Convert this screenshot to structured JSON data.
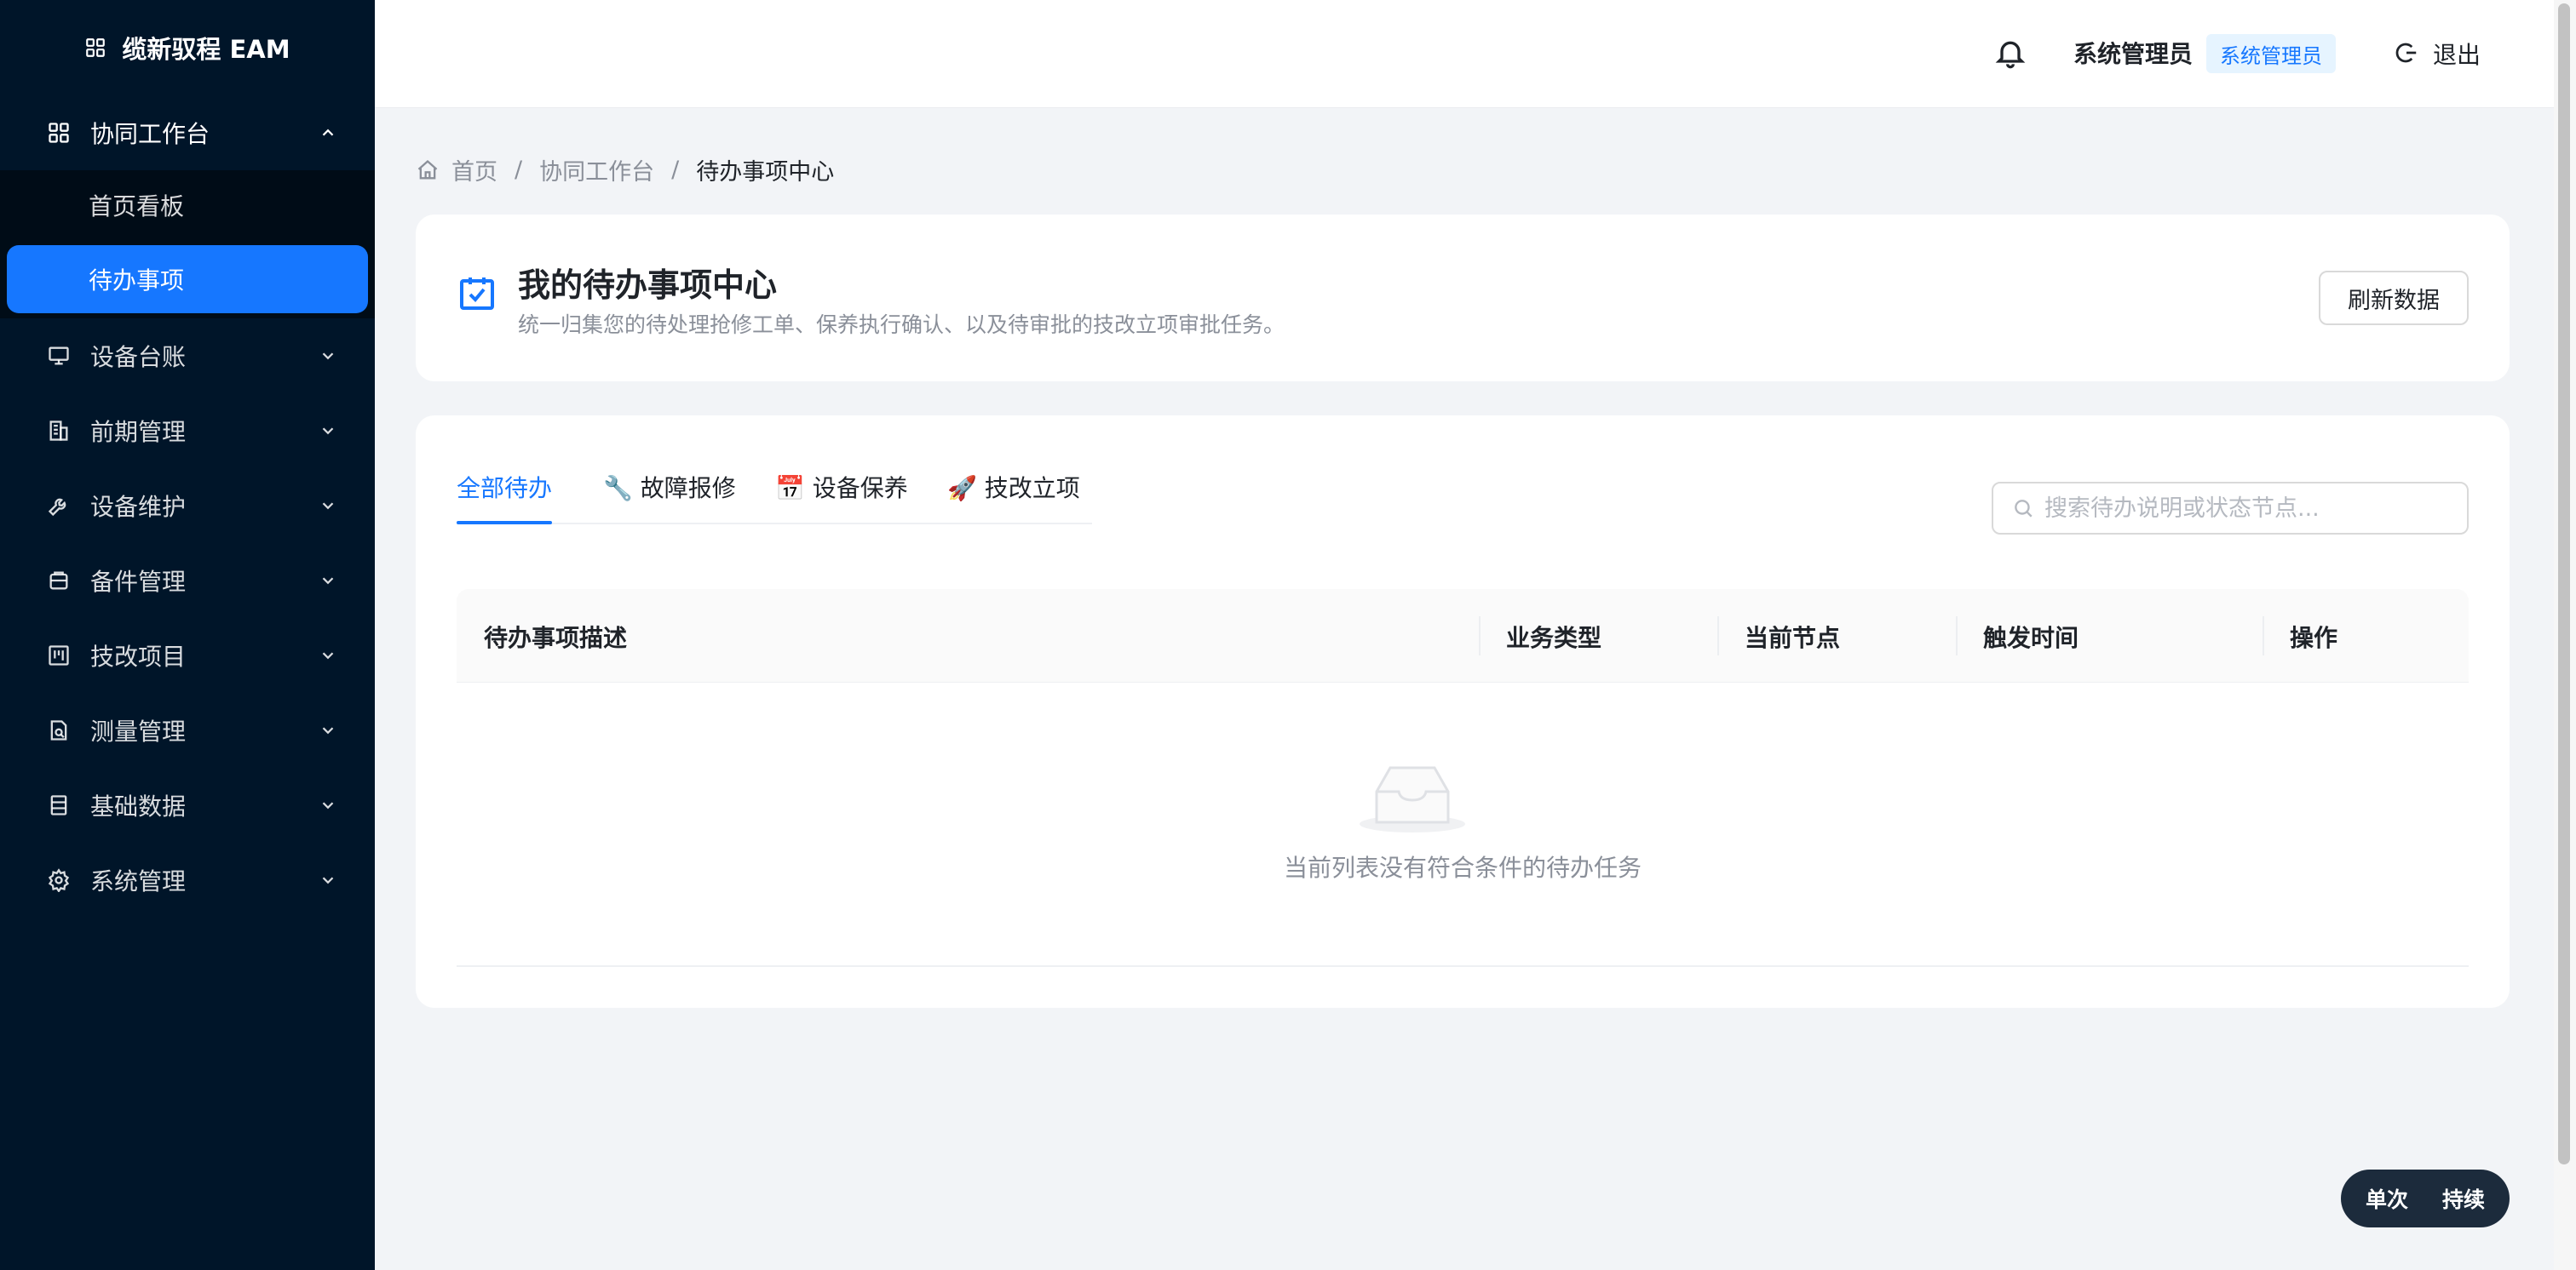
{
  "app": {
    "title": "缆新驭程 EAM"
  },
  "sidebar": {
    "groups": [
      {
        "label": "协同工作台",
        "icon": "grid-icon",
        "open": true,
        "children": [
          {
            "label": "首页看板",
            "active": false
          },
          {
            "label": "待办事项",
            "active": true
          }
        ]
      },
      {
        "label": "设备台账",
        "icon": "monitor-icon"
      },
      {
        "label": "前期管理",
        "icon": "building-icon"
      },
      {
        "label": "设备维护",
        "icon": "wrench-icon"
      },
      {
        "label": "备件管理",
        "icon": "box-icon"
      },
      {
        "label": "技改项目",
        "icon": "project-icon"
      },
      {
        "label": "测量管理",
        "icon": "audit-icon"
      },
      {
        "label": "基础数据",
        "icon": "database-icon"
      },
      {
        "label": "系统管理",
        "icon": "gear-icon"
      }
    ]
  },
  "header": {
    "user_name": "系统管理员",
    "role_tag": "系统管理员",
    "logout_label": "退出"
  },
  "breadcrumb": {
    "home": "首页",
    "level1": "协同工作台",
    "current": "待办事项中心"
  },
  "page_header": {
    "title": "我的待办事项中心",
    "subtitle": "统一归集您的待处理抢修工单、保养执行确认、以及待审批的技改立项审批任务。",
    "refresh_label": "刷新数据"
  },
  "tabs": [
    {
      "label": "全部待办",
      "active": true
    },
    {
      "label": "🔧 故障报修",
      "active": false
    },
    {
      "label": "📅 设备保养",
      "active": false
    },
    {
      "label": "🚀 技改立项",
      "active": false
    }
  ],
  "search": {
    "placeholder": "搜索待办说明或状态节点..."
  },
  "table": {
    "columns": [
      "待办事项描述",
      "业务类型",
      "当前节点",
      "触发时间",
      "操作"
    ],
    "empty_text": "当前列表没有符合条件的待办任务"
  },
  "float_pill": {
    "single": "单次",
    "continuous": "持续"
  },
  "colors": {
    "sidebar_bg": "#001529",
    "accent": "#1677ff",
    "page_bg": "#f2f4f7"
  }
}
